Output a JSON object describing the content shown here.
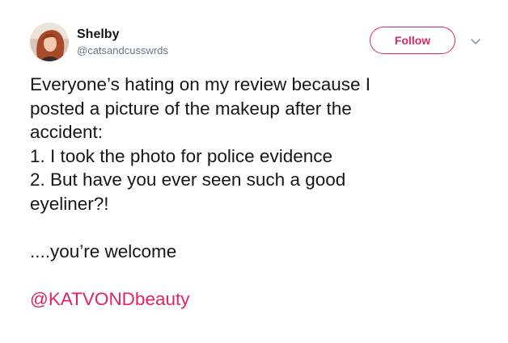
{
  "user": {
    "display_name": "Shelby",
    "handle": "@catsandcusswrds"
  },
  "follow_label": "Follow",
  "icons": {
    "avatar": "profile-photo",
    "caret": "chevron-down-icon"
  },
  "tweet": {
    "lines": [
      "Everyone’s hating on my review because I",
      "posted a picture of the makeup after the",
      "accident:",
      "1. I took the photo for police evidence",
      "2. But have you ever seen such a good",
      "eyeliner?!",
      "",
      "....you’re welcome",
      ""
    ],
    "mention": "@KATVONDbeauty"
  },
  "colors": {
    "accent": "#e0245e",
    "text": "#14171a",
    "secondary": "#657786"
  }
}
